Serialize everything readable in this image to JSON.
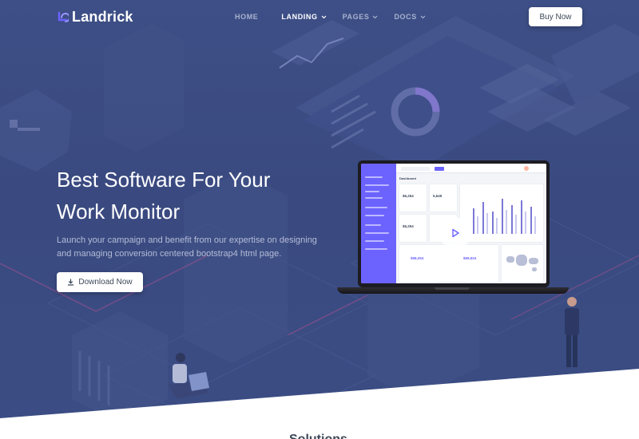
{
  "nav": {
    "brand": "Landrick",
    "items": [
      {
        "label": "HOME"
      },
      {
        "label": "LANDING"
      },
      {
        "label": "PAGES"
      },
      {
        "label": "DOCS"
      }
    ],
    "cta_label": "Buy Now"
  },
  "hero": {
    "title_line1": "Best Software For Your",
    "title_line2": "Work Monitor",
    "description_line1": "Launch your campaign and benefit from our expertise on designing",
    "description_line2": "and managing conversion centered bootstrap4 html page.",
    "download_label": "Download Now"
  },
  "dashboard": {
    "page_title": "Dashboard",
    "stats": [
      "$6,254",
      "5,645",
      "$6,254"
    ],
    "revenue_values": [
      "$58,254",
      "$69,524"
    ]
  },
  "next_section": {
    "heading": "Solutions"
  },
  "colors": {
    "hero_bg": "#3d4f86",
    "accent": "#6c63ff",
    "button_bg": "#ffffff",
    "button_text": "#3c4858"
  },
  "icons": {
    "logo": "landrick-logo-icon",
    "dropdown": "chevron-down-icon",
    "download": "download-icon",
    "play": "play-icon"
  }
}
